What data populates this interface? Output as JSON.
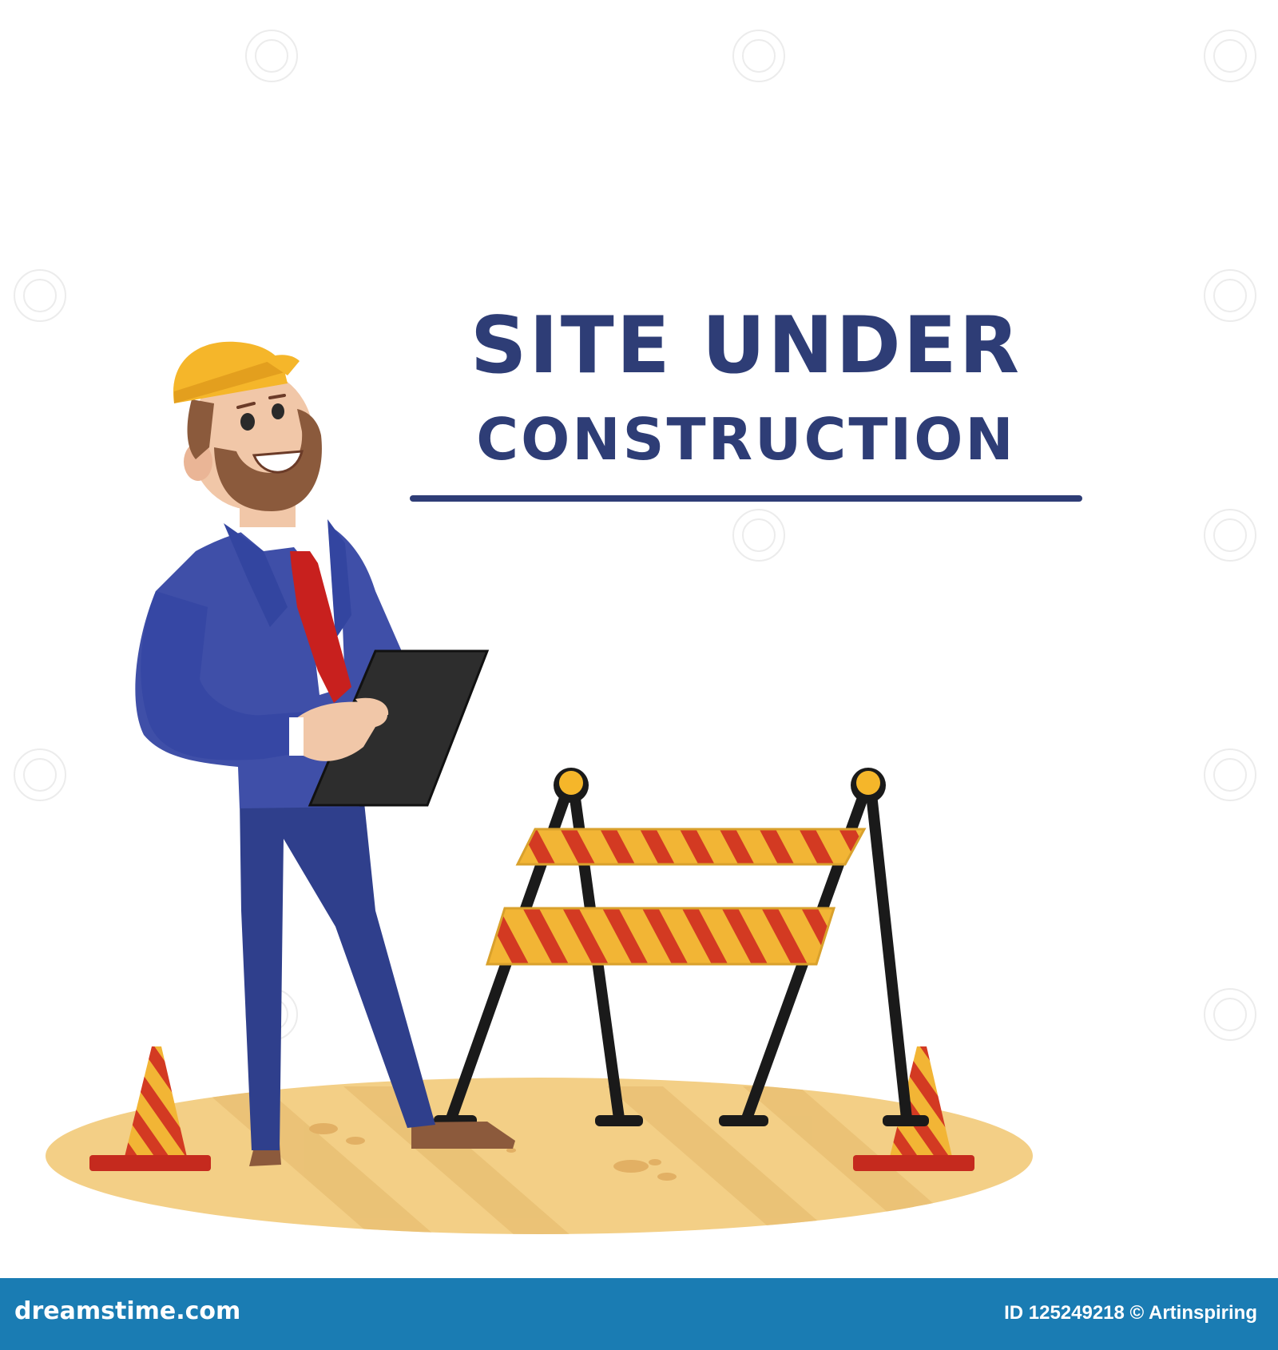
{
  "heading": {
    "line1": "SITE UNDER",
    "line2": "CONSTRUCTION"
  },
  "footer": {
    "site": "dreamstime.com",
    "credit": "ID 125249218 © Artinspiring"
  },
  "colors": {
    "title": "#2e3d76",
    "footer_bg": "#1a7cb3",
    "suit": "#3f4fa8",
    "trousers": "#2f3f8c",
    "tie": "#c8201e",
    "helmet": "#f5b62a",
    "ground": "#f3cf86",
    "barrier_yellow": "#f2b535",
    "barrier_red": "#d33a22"
  },
  "icons": [
    "watermark-swirl-icon",
    "engineer-illustration",
    "clipboard-icon",
    "barrier-illustration",
    "traffic-cone-icon"
  ]
}
